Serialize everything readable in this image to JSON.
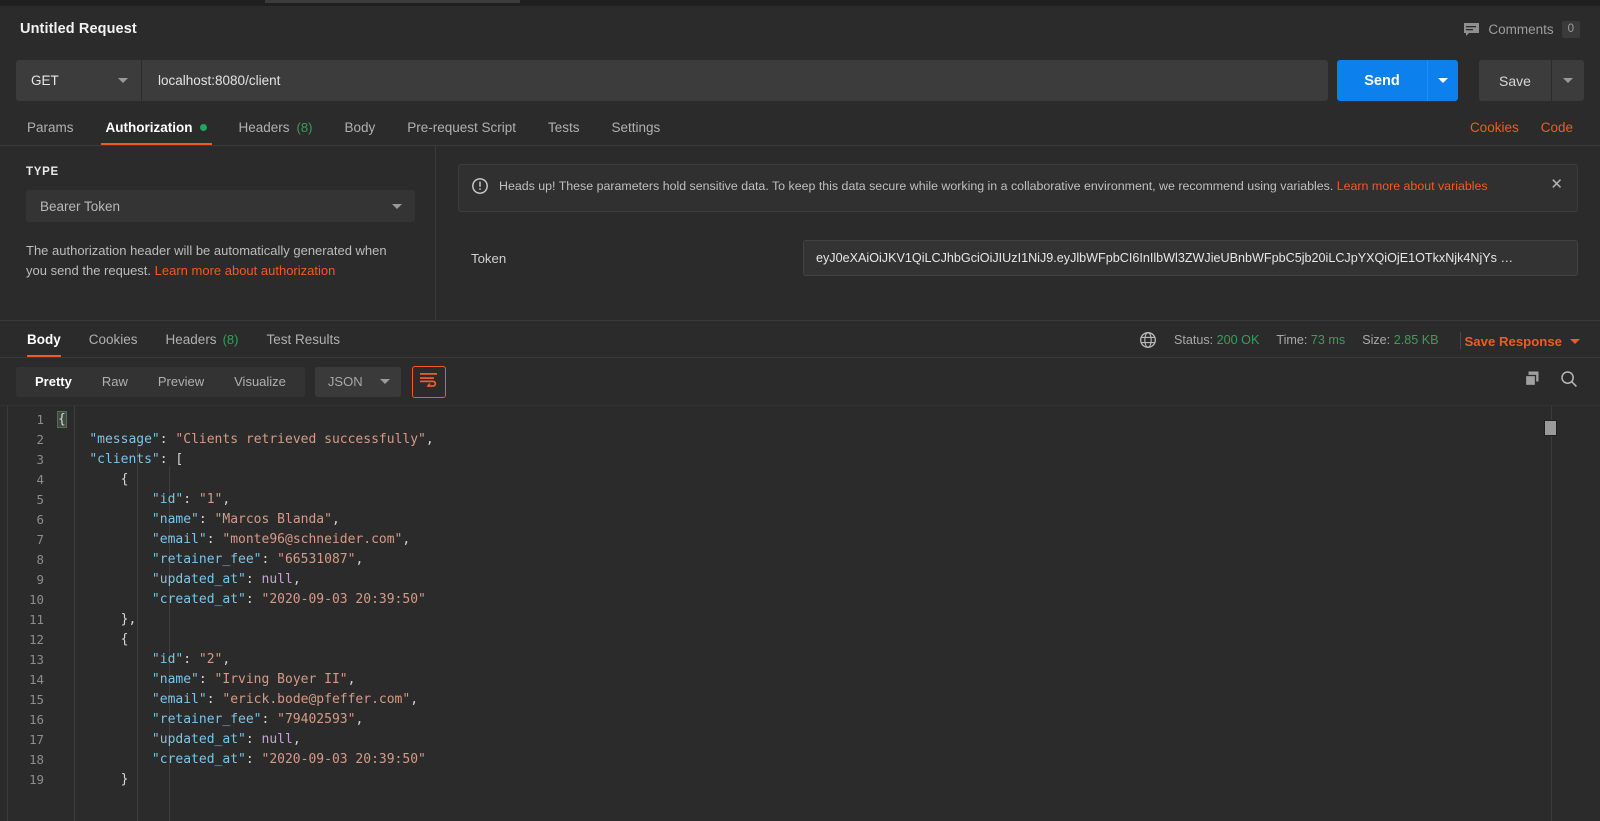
{
  "header": {
    "request_title": "Untitled Request",
    "comments_label": "Comments",
    "comments_count": "0",
    "comment_icon": "comment-icon"
  },
  "url_bar": {
    "method": "GET",
    "url": "localhost:8080/client",
    "send_label": "Send",
    "save_label": "Save",
    "send_color": "#0c80ec"
  },
  "request_tabs": [
    {
      "label": "Params",
      "active": false,
      "dot": false,
      "count": ""
    },
    {
      "label": "Authorization",
      "active": true,
      "dot": true,
      "count": ""
    },
    {
      "label": "Headers",
      "active": false,
      "dot": false,
      "count": "(8)"
    },
    {
      "label": "Body",
      "active": false,
      "dot": false,
      "count": ""
    },
    {
      "label": "Pre-request Script",
      "active": false,
      "dot": false,
      "count": ""
    },
    {
      "label": "Tests",
      "active": false,
      "dot": false,
      "count": ""
    },
    {
      "label": "Settings",
      "active": false,
      "dot": false,
      "count": ""
    }
  ],
  "request_tab_actions": {
    "cookies": "Cookies",
    "code": "Code",
    "accent": "#ef5b25"
  },
  "authorization": {
    "type_label": "TYPE",
    "type_value": "Bearer Token",
    "description": "The authorization header will be automatically generated when you send the request. ",
    "description_link": "Learn more about authorization",
    "notice_icon": "warning-icon",
    "notice_text": "Heads up! These parameters hold sensitive data. To keep this data secure while working in a collaborative environment, we recommend using variables. ",
    "notice_link": "Learn more about variables",
    "notice_close": "✕",
    "token_label": "Token",
    "token_value": "eyJ0eXAiOiJKV1QiLCJhbGciOiJIUzI1NiJ9.eyJlbWFpbCI6InIlbWl3ZWJieUBnbWFpbC5jb20iLCJpYXQiOjE1OTkxNjk4NjYs …"
  },
  "response_tabs": [
    {
      "label": "Body",
      "active": true,
      "count": ""
    },
    {
      "label": "Cookies",
      "active": false,
      "count": ""
    },
    {
      "label": "Headers",
      "active": false,
      "count": "(8)"
    },
    {
      "label": "Test Results",
      "active": false,
      "count": ""
    }
  ],
  "response_meta": {
    "globe_icon": "globe-icon",
    "status_label": "Status:",
    "status_value": "200 OK",
    "time_label": "Time:",
    "time_value": "73 ms",
    "size_label": "Size:",
    "size_value": "2.85 KB",
    "save_response": "Save Response",
    "success_color": "#3d9c5a"
  },
  "view_bar": {
    "tabs": [
      {
        "label": "Pretty",
        "active": true
      },
      {
        "label": "Raw",
        "active": false
      },
      {
        "label": "Preview",
        "active": false
      },
      {
        "label": "Visualize",
        "active": false
      }
    ],
    "format": "JSON",
    "wrap_icon": "word-wrap-icon",
    "copy_icon": "copy-icon",
    "search_icon": "search-icon"
  },
  "code_lines": [
    {
      "num": "1",
      "tokens": [
        {
          "t": "{",
          "c": "brace-hl"
        }
      ]
    },
    {
      "num": "2",
      "tokens": [
        {
          "t": "    ",
          "c": "p"
        },
        {
          "t": "\"message\"",
          "c": "k"
        },
        {
          "t": ": ",
          "c": "p"
        },
        {
          "t": "\"Clients retrieved successfully\"",
          "c": "s"
        },
        {
          "t": ",",
          "c": "p"
        }
      ]
    },
    {
      "num": "3",
      "tokens": [
        {
          "t": "    ",
          "c": "p"
        },
        {
          "t": "\"clients\"",
          "c": "k"
        },
        {
          "t": ": [",
          "c": "p"
        }
      ]
    },
    {
      "num": "4",
      "tokens": [
        {
          "t": "        {",
          "c": "p"
        }
      ]
    },
    {
      "num": "5",
      "tokens": [
        {
          "t": "            ",
          "c": "p"
        },
        {
          "t": "\"id\"",
          "c": "k"
        },
        {
          "t": ": ",
          "c": "p"
        },
        {
          "t": "\"1\"",
          "c": "s"
        },
        {
          "t": ",",
          "c": "p"
        }
      ]
    },
    {
      "num": "6",
      "tokens": [
        {
          "t": "            ",
          "c": "p"
        },
        {
          "t": "\"name\"",
          "c": "k"
        },
        {
          "t": ": ",
          "c": "p"
        },
        {
          "t": "\"Marcos Blanda\"",
          "c": "s"
        },
        {
          "t": ",",
          "c": "p"
        }
      ]
    },
    {
      "num": "7",
      "tokens": [
        {
          "t": "            ",
          "c": "p"
        },
        {
          "t": "\"email\"",
          "c": "k"
        },
        {
          "t": ": ",
          "c": "p"
        },
        {
          "t": "\"monte96@schneider.com\"",
          "c": "s"
        },
        {
          "t": ",",
          "c": "p"
        }
      ]
    },
    {
      "num": "8",
      "tokens": [
        {
          "t": "            ",
          "c": "p"
        },
        {
          "t": "\"retainer_fee\"",
          "c": "k"
        },
        {
          "t": ": ",
          "c": "p"
        },
        {
          "t": "\"66531087\"",
          "c": "s"
        },
        {
          "t": ",",
          "c": "p"
        }
      ]
    },
    {
      "num": "9",
      "tokens": [
        {
          "t": "            ",
          "c": "p"
        },
        {
          "t": "\"updated_at\"",
          "c": "k"
        },
        {
          "t": ": ",
          "c": "p"
        },
        {
          "t": "null",
          "c": "n"
        },
        {
          "t": ",",
          "c": "p"
        }
      ]
    },
    {
      "num": "10",
      "tokens": [
        {
          "t": "            ",
          "c": "p"
        },
        {
          "t": "\"created_at\"",
          "c": "k"
        },
        {
          "t": ": ",
          "c": "p"
        },
        {
          "t": "\"2020-09-03 20:39:50\"",
          "c": "s"
        }
      ]
    },
    {
      "num": "11",
      "tokens": [
        {
          "t": "        },",
          "c": "p"
        }
      ]
    },
    {
      "num": "12",
      "tokens": [
        {
          "t": "        {",
          "c": "p"
        }
      ]
    },
    {
      "num": "13",
      "tokens": [
        {
          "t": "            ",
          "c": "p"
        },
        {
          "t": "\"id\"",
          "c": "k"
        },
        {
          "t": ": ",
          "c": "p"
        },
        {
          "t": "\"2\"",
          "c": "s"
        },
        {
          "t": ",",
          "c": "p"
        }
      ]
    },
    {
      "num": "14",
      "tokens": [
        {
          "t": "            ",
          "c": "p"
        },
        {
          "t": "\"name\"",
          "c": "k"
        },
        {
          "t": ": ",
          "c": "p"
        },
        {
          "t": "\"Irving Boyer II\"",
          "c": "s"
        },
        {
          "t": ",",
          "c": "p"
        }
      ]
    },
    {
      "num": "15",
      "tokens": [
        {
          "t": "            ",
          "c": "p"
        },
        {
          "t": "\"email\"",
          "c": "k"
        },
        {
          "t": ": ",
          "c": "p"
        },
        {
          "t": "\"erick.bode@pfeffer.com\"",
          "c": "s"
        },
        {
          "t": ",",
          "c": "p"
        }
      ]
    },
    {
      "num": "16",
      "tokens": [
        {
          "t": "            ",
          "c": "p"
        },
        {
          "t": "\"retainer_fee\"",
          "c": "k"
        },
        {
          "t": ": ",
          "c": "p"
        },
        {
          "t": "\"79402593\"",
          "c": "s"
        },
        {
          "t": ",",
          "c": "p"
        }
      ]
    },
    {
      "num": "17",
      "tokens": [
        {
          "t": "            ",
          "c": "p"
        },
        {
          "t": "\"updated_at\"",
          "c": "k"
        },
        {
          "t": ": ",
          "c": "p"
        },
        {
          "t": "null",
          "c": "n"
        },
        {
          "t": ",",
          "c": "p"
        }
      ]
    },
    {
      "num": "18",
      "tokens": [
        {
          "t": "            ",
          "c": "p"
        },
        {
          "t": "\"created_at\"",
          "c": "k"
        },
        {
          "t": ": ",
          "c": "p"
        },
        {
          "t": "\"2020-09-03 20:39:50\"",
          "c": "s"
        }
      ]
    },
    {
      "num": "19",
      "tokens": [
        {
          "t": "        }",
          "c": "p"
        }
      ]
    }
  ]
}
